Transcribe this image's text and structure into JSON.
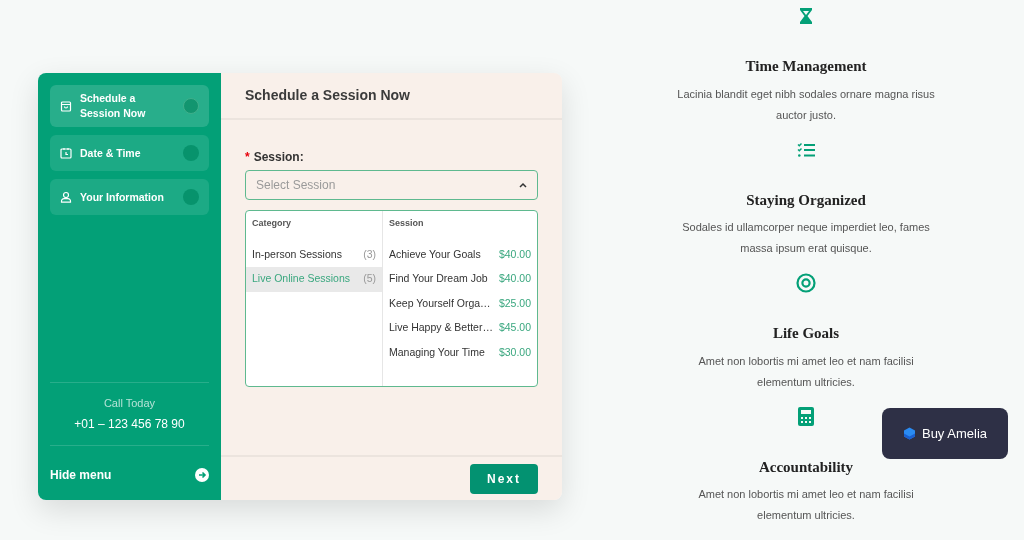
{
  "sidebar": {
    "steps": [
      {
        "label": "Schedule a Session Now",
        "selected": true
      },
      {
        "label": "Date & Time",
        "selected": false
      },
      {
        "label": "Your Information",
        "selected": false
      }
    ],
    "call_label": "Call Today",
    "phone": "+01 – 123 456 78 90",
    "hide_menu": "Hide menu"
  },
  "main": {
    "title": "Schedule a Session Now",
    "field": {
      "label": "Session:",
      "required_mark": "*",
      "placeholder": "Select Session",
      "expanded": true
    },
    "dropdown": {
      "category_header": "Category",
      "session_header": "Session",
      "categories": [
        {
          "name": "In-person Sessions",
          "count": "(3)",
          "selected": false
        },
        {
          "name": "Live Online Sessions",
          "count": "(5)",
          "selected": true
        }
      ],
      "sessions": [
        {
          "name": "Achieve Your Goals",
          "price": "$40.00"
        },
        {
          "name": "Find Your Dream Job",
          "price": "$40.00"
        },
        {
          "name": "Keep Yourself Orga…",
          "price": "$25.00"
        },
        {
          "name": "Live Happy & Better…",
          "price": "$45.00"
        },
        {
          "name": "Managing Your Time",
          "price": "$30.00"
        }
      ]
    },
    "next_button": "Next"
  },
  "features": [
    {
      "title": "Time Management",
      "text": "Lacinia blandit eget nibh sodales ornare magna risus auctor justo."
    },
    {
      "title": "Staying Organized",
      "text": "Sodales id ullamcorper neque imperdiet leo, fames massa ipsum erat quisque."
    },
    {
      "title": "Life Goals",
      "text": "Amet non lobortis mi amet leo et nam facilisi elementum ultricies."
    },
    {
      "title": "Accountability",
      "text": "Amet non lobortis mi amet leo et nam facilisi elementum ultricies."
    }
  ],
  "buy_button": "Buy Amelia"
}
